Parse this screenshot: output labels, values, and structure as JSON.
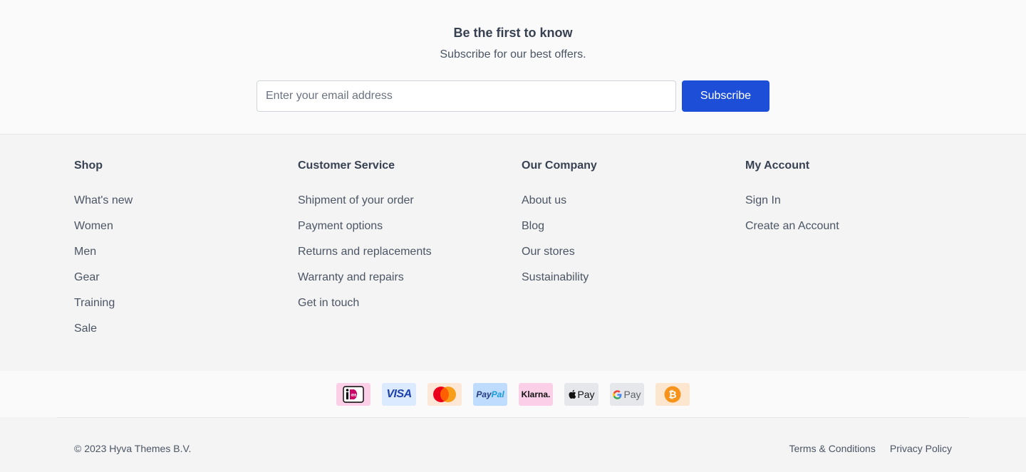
{
  "newsletter": {
    "title": "Be the first to know",
    "subtitle": "Subscribe for our best offers.",
    "email_placeholder": "Enter your email address",
    "button_label": "Subscribe"
  },
  "columns": [
    {
      "heading": "Shop",
      "links": [
        "What's new",
        "Women",
        "Men",
        "Gear",
        "Training",
        "Sale"
      ]
    },
    {
      "heading": "Customer Service",
      "links": [
        "Shipment of your order",
        "Payment options",
        "Returns and replacements",
        "Warranty and repairs",
        "Get in touch"
      ]
    },
    {
      "heading": "Our Company",
      "links": [
        "About us",
        "Blog",
        "Our stores",
        "Sustainability"
      ]
    },
    {
      "heading": "My Account",
      "links": [
        "Sign In",
        "Create an Account"
      ]
    }
  ],
  "payments": {
    "icons": [
      "ideal-icon",
      "visa-icon",
      "mastercard-icon",
      "paypal-icon",
      "klarna-icon",
      "apple-pay-icon",
      "google-pay-icon",
      "bitcoin-icon"
    ],
    "visa_text": "VISA",
    "paypal_pay": "Pay",
    "paypal_pal": "Pal",
    "klarna_text": "Klarna.",
    "applepay_text": "Pay",
    "gpay_text": "Pay",
    "ideal_text": "iDEAL"
  },
  "colors": {
    "accent": "#1d4ed8",
    "text": "#374151",
    "newsletter_bg": "#fafafa",
    "footer_bg": "#f4f4f5"
  },
  "footer": {
    "copyright": "© 2023 Hyva Themes B.V.",
    "terms": "Terms & Conditions",
    "privacy": "Privacy Policy"
  }
}
